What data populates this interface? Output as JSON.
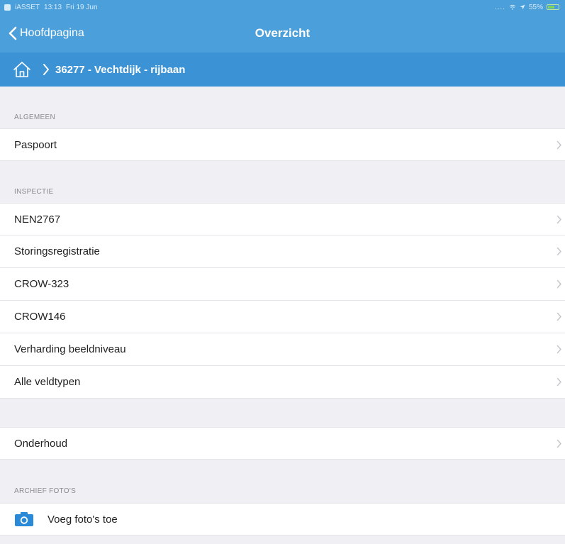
{
  "status_bar": {
    "carrier": "iASSET",
    "time": "13:13",
    "date": "Fri 19 Jun",
    "signal": "....",
    "battery": "55%"
  },
  "nav": {
    "back_label": "Hoofdpagina",
    "title": "Overzicht"
  },
  "breadcrumb": {
    "current": "36277 - Vechtdijk - rijbaan"
  },
  "sections": {
    "algemeen": {
      "header": "ALGEMEEN",
      "items": [
        {
          "label": "Paspoort"
        }
      ]
    },
    "inspectie": {
      "header": "INSPECTIE",
      "items": [
        {
          "label": "NEN2767"
        },
        {
          "label": "Storingsregistratie"
        },
        {
          "label": "CROW-323"
        },
        {
          "label": "CROW146"
        },
        {
          "label": "Verharding beeldniveau"
        },
        {
          "label": "Alle veldtypen"
        }
      ]
    },
    "onderhoud": {
      "items": [
        {
          "label": "Onderhoud"
        }
      ]
    },
    "archief": {
      "header": "ARCHIEF FOTO'S",
      "items": [
        {
          "label": "Voeg foto's toe"
        }
      ]
    }
  },
  "icons": {
    "back": "chevron-left-icon",
    "home": "home-icon",
    "breadcrumb_separator": "chevron-right-icon",
    "row_disclosure": "chevron-right-icon",
    "photo": "camera-icon"
  },
  "colors": {
    "nav_bar": "#4b9fda",
    "breadcrumb_bar": "#3b93d6",
    "background": "#efeff4",
    "row_background": "#ffffff",
    "section_header_text": "#8a8a8f",
    "camera_icon": "#2a8ad8"
  }
}
